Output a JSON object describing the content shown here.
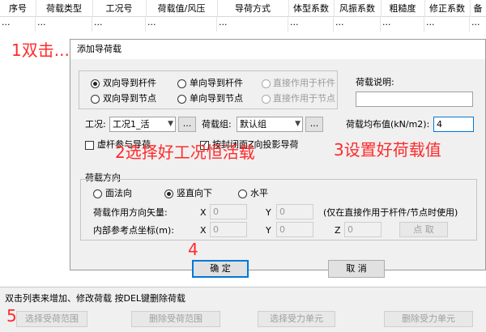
{
  "table": {
    "headers": [
      "序号",
      "荷载类型",
      "工况号",
      "荷载值/风压",
      "导荷方式",
      "体型系数",
      "风振系数",
      "粗糙度",
      "修正系数",
      "备"
    ],
    "row_cells": [
      "...",
      "...",
      "...",
      "...",
      "...",
      "...",
      "...",
      "...",
      "...",
      "..."
    ]
  },
  "dialog": {
    "title": "添加导荷载",
    "radio_options": [
      "双向导到杆件",
      "单向导到杆件",
      "直接作用于杆件",
      "双向导到节点",
      "单向导到节点",
      "直接作用于节点"
    ],
    "load_desc_label": "荷载说明:",
    "load_desc_value": "",
    "case_label": "工况:",
    "case_value": "工况1_活",
    "load_group_label": "荷载组:",
    "load_group_value": "默认组",
    "ellipsis": "...",
    "load_value_label": "荷载均布值(kN/m2):",
    "load_value": "4",
    "virtual_member_label": "虚杆参与导荷",
    "closed_face_label": "按封闭面Z向投影导荷",
    "direction": {
      "group_label": "荷载方向",
      "options": [
        "面法向",
        "竖直向下",
        "水平"
      ],
      "vector_label": "荷载作用方向矢量:",
      "ref_point_label": "内部参考点坐标(m):",
      "x_label": "X",
      "y_label": "Y",
      "z_label": "Z",
      "vector_x": "0",
      "vector_y": "0",
      "ref_x": "0",
      "ref_y": "0",
      "ref_z": "0",
      "note": "(仅在直接作用于杆件/节点时使用)",
      "pick_label": "点 取"
    },
    "ok_label": "确  定",
    "cancel_label": "取  消"
  },
  "status": {
    "hint": "双击列表来增加、修改荷载   按DEL键删除荷载",
    "buttons": [
      "选择受荷范围",
      "删除受荷范围",
      "选择受力单元",
      "删除受力单元"
    ]
  },
  "annotations": {
    "step1": "1双击...",
    "step2": "2选择好工况恒活载",
    "step3": "3设置好荷载值",
    "step4": "4",
    "step5": "5"
  },
  "colors": {
    "annotation": "#ff2a2a",
    "focus": "#0078d7"
  }
}
